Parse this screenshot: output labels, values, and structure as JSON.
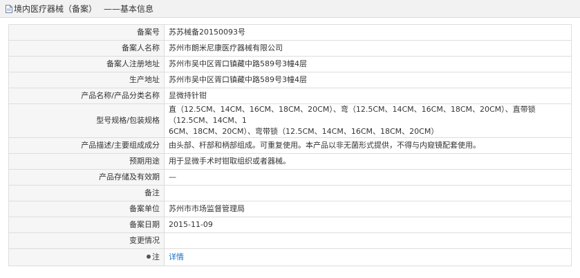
{
  "header": {
    "title": "境内医疗器械（备案）",
    "subtitle": "——基本信息"
  },
  "rows": [
    {
      "label": "备案号",
      "value": "苏苏械备20150093号"
    },
    {
      "label": "备案人名称",
      "value": "苏州市朗米尼康医疗器械有限公司"
    },
    {
      "label": "备案人注册地址",
      "value": "苏州市吴中区胥口镇藏中路589号3幢4层"
    },
    {
      "label": "生产地址",
      "value": "苏州市吴中区胥口镇藏中路589号3幢4层"
    },
    {
      "label": "产品名称/产品分类名称",
      "value": "显微持针钳"
    },
    {
      "label": "型号规格/包装规格",
      "value_line1": "直（12.5CM、14CM、16CM、18CM、20CM）、弯（12.5CM、14CM、16CM、18CM、20CM）、直带锁（12.5CM、14CM、1",
      "value_line2": "6CM、18CM、20CM）、弯带锁（12.5CM、14CM、16CM、18CM、20CM）"
    },
    {
      "label": "产品描述/主要组成成分",
      "value": "由头部、杆部和柄部组成。可重复使用。本产品以非无菌形式提供，不得与内窥镜配套使用。"
    },
    {
      "label": "预期用途",
      "value": "用于显微手术时钳取组织或者器械。"
    },
    {
      "label": "产品存储及有效期",
      "value": "—"
    },
    {
      "label": "备注",
      "value": ""
    },
    {
      "label": "备案单位",
      "value": "苏州市市场监督管理局"
    },
    {
      "label": "备案日期",
      "value": "2015-11-09"
    },
    {
      "label": "变更情况",
      "value": ""
    },
    {
      "label": "注",
      "value": "详情"
    }
  ]
}
